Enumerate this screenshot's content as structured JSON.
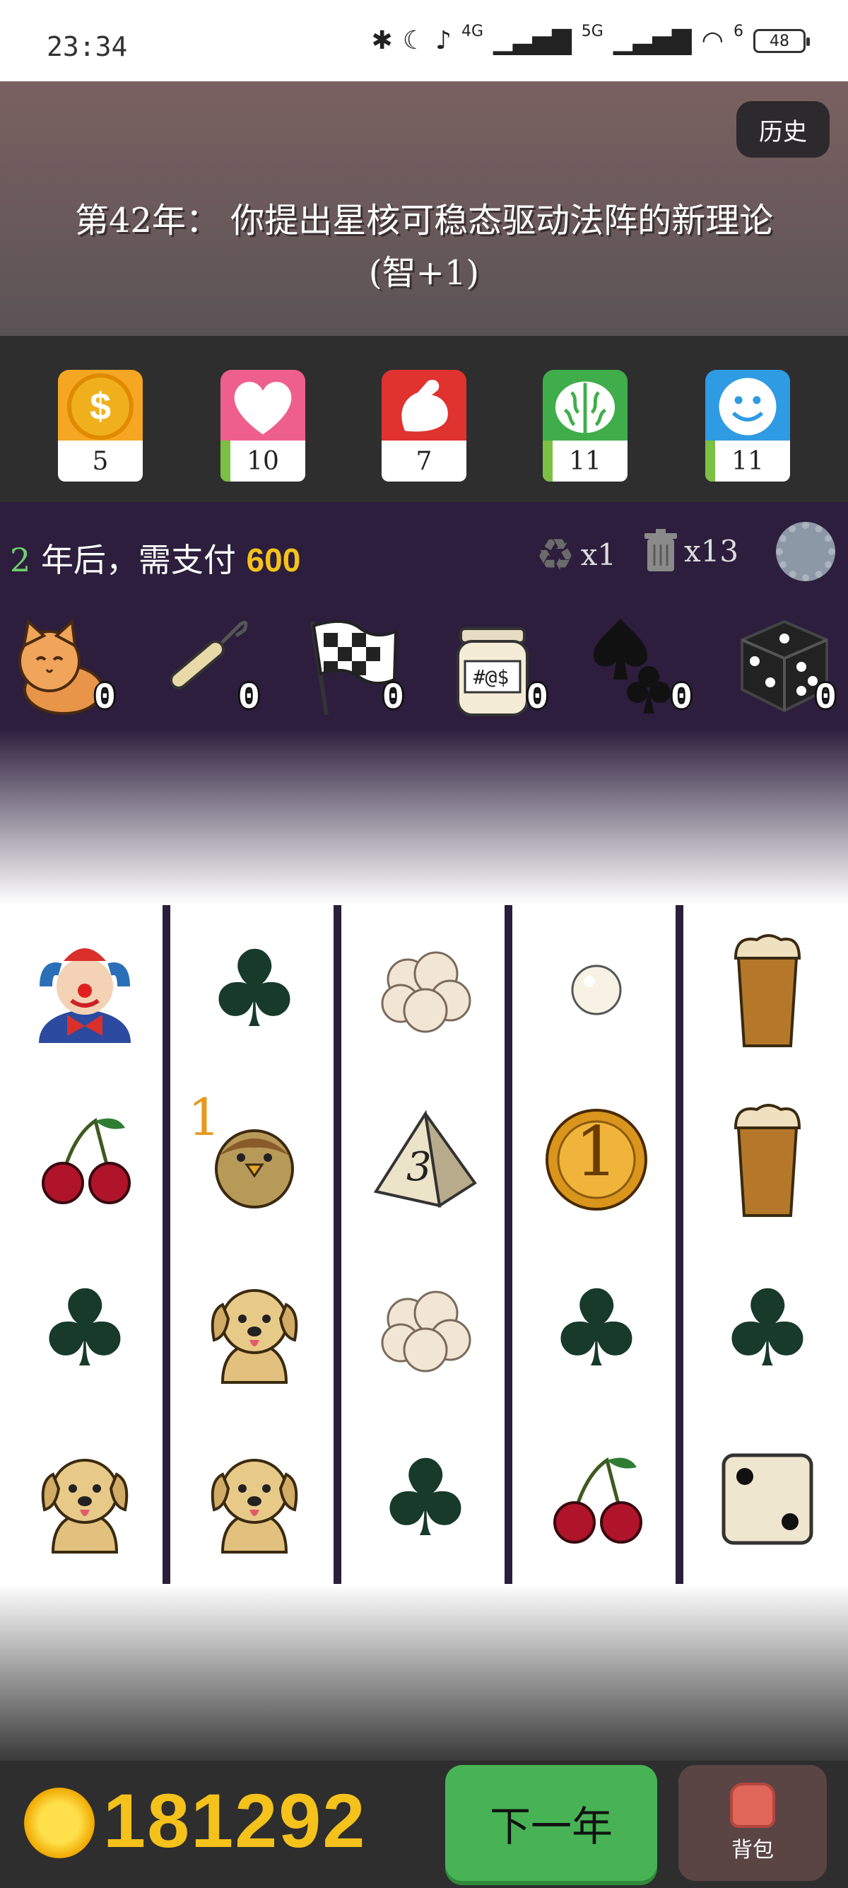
{
  "status_bar": {
    "time": "23:34",
    "battery": "48",
    "net1": "4G",
    "net2": "5G",
    "wifi_sub": "6"
  },
  "banner": {
    "history_label": "历史",
    "event_line1": "第42年： 你提出星核可稳态驱动法阵的新理论",
    "event_line2": "(智+1)"
  },
  "stats": [
    {
      "icon": "dollar-coin-icon",
      "value": "5",
      "color": "#f5a623",
      "fill": 0
    },
    {
      "icon": "heart-icon",
      "value": "10",
      "color": "#ef5f8e",
      "fill": 0.1
    },
    {
      "icon": "strength-arm-icon",
      "value": "7",
      "color": "#e0322e",
      "fill": 0
    },
    {
      "icon": "brain-icon",
      "value": "11",
      "color": "#3fae4a",
      "fill": 0.1
    },
    {
      "icon": "smiley-face-icon",
      "value": "11",
      "color": "#2f9be3",
      "fill": 0.1
    }
  ],
  "rent": {
    "years": "2",
    "text": "年后，需支付",
    "amount": "600"
  },
  "tools": {
    "recycle": "x1",
    "trash": "x13"
  },
  "items": [
    {
      "name": "cat",
      "count": "0"
    },
    {
      "name": "lockpick",
      "count": "0"
    },
    {
      "name": "checkered-flag",
      "count": "0"
    },
    {
      "name": "jar",
      "count": "0",
      "jar_label": "#@$"
    },
    {
      "name": "card-suits",
      "count": "0"
    },
    {
      "name": "dice",
      "count": "0"
    }
  ],
  "reels": [
    [
      "clown",
      "cherry",
      "club",
      "dog"
    ],
    [
      "club",
      "sparrow",
      "dog",
      "dog"
    ],
    [
      "cloud",
      "d4-die",
      "cloud",
      "club"
    ],
    [
      "pearl",
      "coin",
      "club",
      "cherry"
    ],
    [
      "beer",
      "beer",
      "club",
      "die-two"
    ]
  ],
  "reel_bonus": {
    "reel": 1,
    "row": 1,
    "value": "1"
  },
  "coin_value": "1",
  "d4_value": "3",
  "bottom": {
    "coins": "181292",
    "next_label": "下一年",
    "bag_label": "背包"
  }
}
